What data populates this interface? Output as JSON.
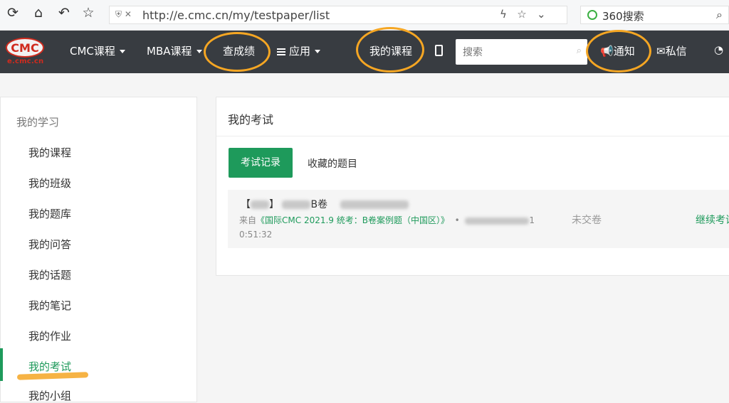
{
  "browser": {
    "url": "http://e.cmc.cn/my/testpaper/list",
    "search_engine_label": "360搜索"
  },
  "brand": {
    "logo_text": "CMC",
    "logo_domain": "e.cmc.cn"
  },
  "nav": {
    "cmc_courses": "CMC课程",
    "mba_courses": "MBA课程",
    "check_scores": "查成绩",
    "apps": "应用",
    "my_courses": "我的课程",
    "search_placeholder": "搜索",
    "notifications": "通知",
    "messages": "私信"
  },
  "sidebar": {
    "heading": "我的学习",
    "items": [
      {
        "label": "我的课程"
      },
      {
        "label": "我的班级"
      },
      {
        "label": "我的题库"
      },
      {
        "label": "我的问答"
      },
      {
        "label": "我的话题"
      },
      {
        "label": "我的笔记"
      },
      {
        "label": "我的作业"
      },
      {
        "label": "我的考试"
      },
      {
        "label": "我的小组"
      }
    ],
    "active_item": "我的考试"
  },
  "main": {
    "title": "我的考试",
    "tabs": [
      {
        "label": "考试记录",
        "active": true
      },
      {
        "label": "收藏的题目",
        "active": false
      }
    ],
    "record": {
      "line1_prefix": "【",
      "line1_bracket_end": "】",
      "line1_suffix": "B卷",
      "source_prefix": "来自",
      "source_link": "《国际CMC 2021.9 统考：B卷案例题（中国区）》",
      "bullet": "•",
      "date_tail": "1",
      "time": "0:51:32",
      "status": "未交卷",
      "action": "继续考试"
    }
  },
  "colors": {
    "nav_bg": "#383c41",
    "accent_green": "#1e9a5b",
    "highlight_orange": "#f5a623"
  }
}
